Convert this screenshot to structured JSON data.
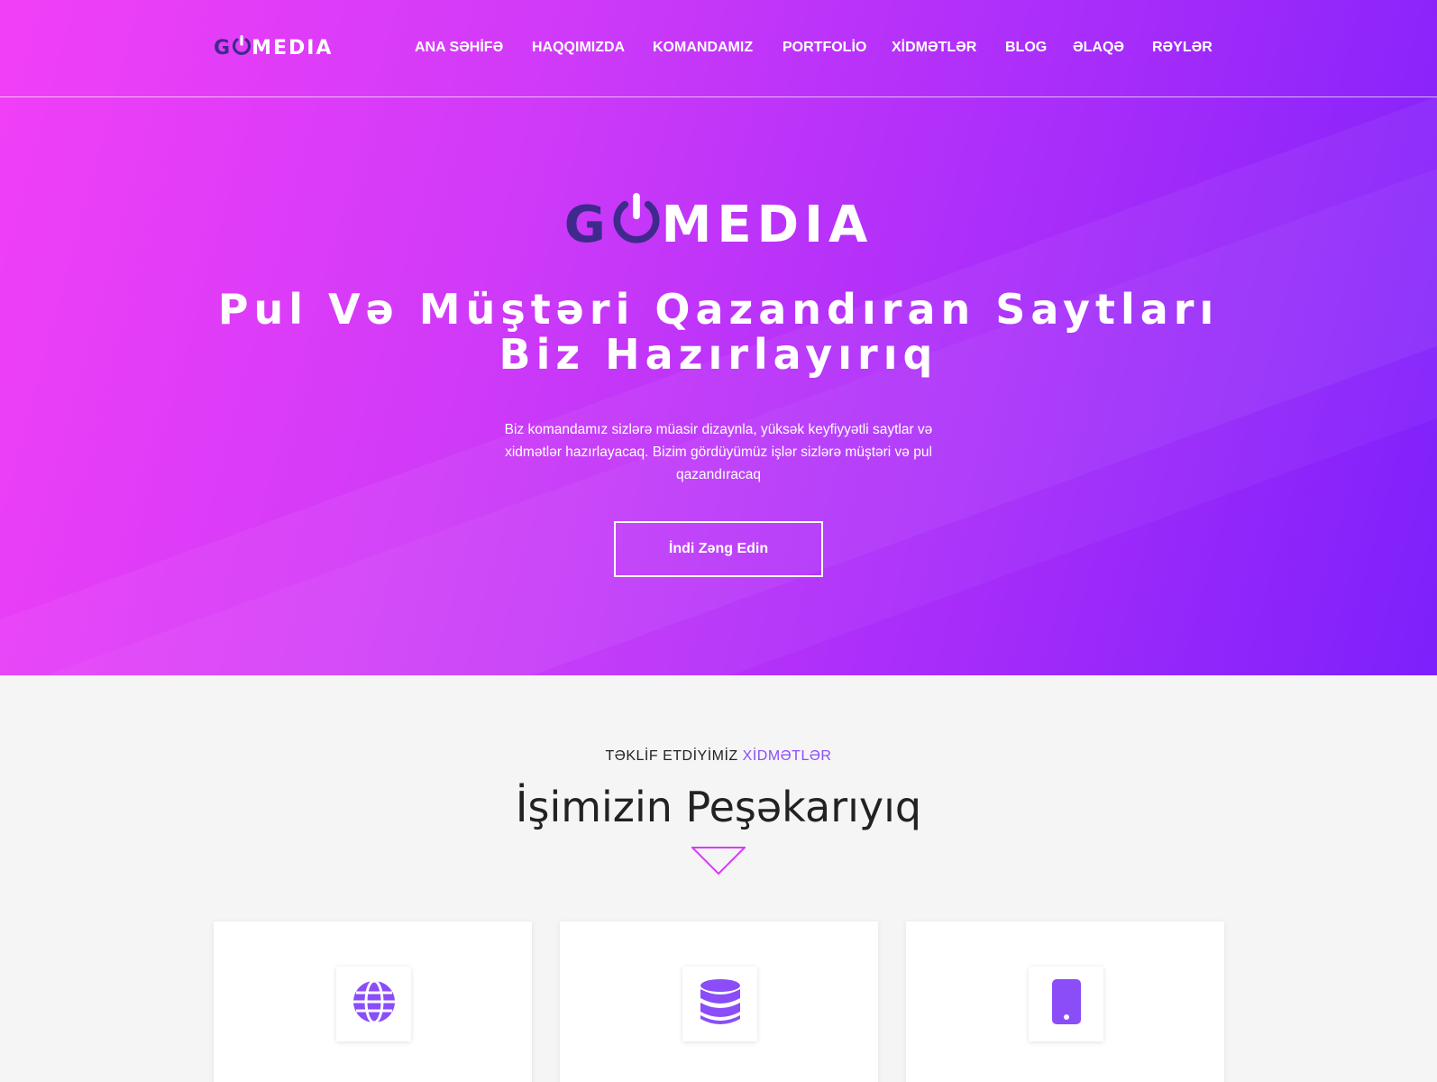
{
  "brand": {
    "logo_g": "G",
    "logo_o": "O",
    "logo_rest": "MEDIA",
    "accent_color": "#8a4df7",
    "logo_dark_color": "#3e2a8c"
  },
  "nav": {
    "items": [
      {
        "label": "ANA SƏHİFƏ"
      },
      {
        "label": "HAQQIMIZDA"
      },
      {
        "label": "KOMANDAMIZ"
      },
      {
        "label": "PORTFOLİO"
      },
      {
        "label": "XİDMƏTLƏR"
      },
      {
        "label": "BLOG"
      },
      {
        "label": "ƏLAQƏ"
      },
      {
        "label": "RƏYLƏR"
      }
    ]
  },
  "hero": {
    "title_line1": "Pul Və Müştəri Qazandıran Saytları",
    "title_line2": "Biz Hazırlayırıq",
    "description": "Biz komandamız sizlərə müasir dizaynla, yüksək keyfiyyətli saytlar və xidmətlər hazırlayacaq. Bizim gördüyümüz işlər sizlərə müştəri və pul qazandıracaq",
    "cta_label": "İndi Zəng Edin",
    "gradient": [
      "#f23ff7",
      "#7d20fb"
    ]
  },
  "services": {
    "sub_heading_prefix": "TƏKLİF ETDİYİMİZ",
    "sub_heading_accent": "XİDMƏTLƏR",
    "title": "İşimizin Peşəkarıyıq",
    "cards": [
      {
        "icon": "globe-icon"
      },
      {
        "icon": "database-icon"
      },
      {
        "icon": "mobile-icon"
      }
    ]
  }
}
